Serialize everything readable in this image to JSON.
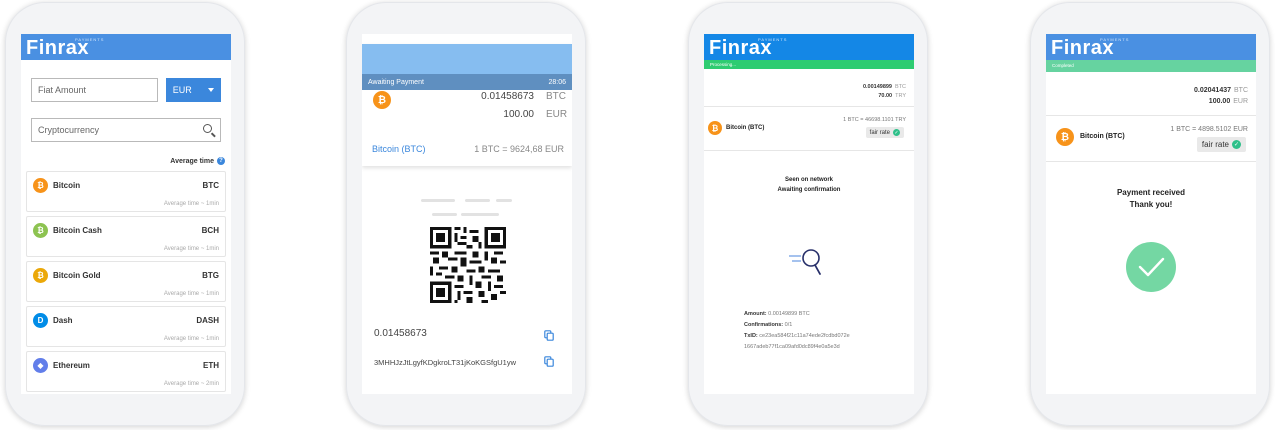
{
  "brand": {
    "name": "Finrax",
    "tag": "PAYMENTS"
  },
  "screen1": {
    "fiat_placeholder": "Fiat Amount",
    "currency": "EUR",
    "crypto_placeholder": "Cryptocurrency",
    "avg_time_header": "Average time",
    "coins": [
      {
        "name": "Bitcoin",
        "symbol": "BTC",
        "time": "Average time ~ 1min",
        "icon": "bitcoin-icon",
        "glyph": "₿",
        "color": "#f7931a"
      },
      {
        "name": "Bitcoin Cash",
        "symbol": "BCH",
        "time": "Average time ~ 1min",
        "icon": "bitcoin-cash-icon",
        "glyph": "₿",
        "color": "#8dc351"
      },
      {
        "name": "Bitcoin Gold",
        "symbol": "BTG",
        "time": "Average time ~ 1min",
        "icon": "bitcoin-gold-icon",
        "glyph": "₿",
        "color": "#eba809"
      },
      {
        "name": "Dash",
        "symbol": "DASH",
        "time": "Average time ~ 1min",
        "icon": "dash-icon",
        "glyph": "D",
        "color": "#008ce7"
      },
      {
        "name": "Ethereum",
        "symbol": "ETH",
        "time": "Average time ~ 2min",
        "icon": "ethereum-icon",
        "glyph": "◆",
        "color": "#627eea"
      }
    ]
  },
  "screen2": {
    "status": "Awaiting Payment",
    "timer": "28:06",
    "crypto_amount": "0.01458673",
    "crypto_unit": "BTC",
    "fiat_amount": "100.00",
    "fiat_unit": "EUR",
    "coin_label": "Bitcoin (BTC)",
    "rate": "1 BTC = 9624,68 EUR",
    "copy_amount": "0.01458673",
    "address": "3MHHJzJtLgyfKDgkroLT31jKoKGSfgU1yw"
  },
  "screen3": {
    "progress": "Processing...",
    "crypto_amount": "0.00149899",
    "crypto_unit": "BTC",
    "fiat_amount": "70.00",
    "fiat_unit": "TRY",
    "coin_label": "Bitcoin (BTC)",
    "rate": "1 BTC = 46698.1101 TRY",
    "fair_rate": "fair rate",
    "status_line1": "Seen on network",
    "status_line2": "Awaiting confirmation",
    "amount_label": "Amount:",
    "amount_value": "0.00149899 BTC",
    "confirm_label": "Confirmations:",
    "confirm_value": "0/1",
    "txid_label": "TxID:",
    "txid_value1": "ce23ea584f21c11a74ede2fcdbd072e",
    "txid_value2": "1667adeb77f1ca09afd0dc89f4e0a5e3d"
  },
  "screen4": {
    "progress": "Completed",
    "crypto_amount": "0.02041437",
    "crypto_unit": "BTC",
    "fiat_amount": "100.00",
    "fiat_unit": "EUR",
    "coin_label": "Bitcoin (BTC)",
    "rate": "1 BTC = 4898.5102 EUR",
    "fair_rate": "fair rate",
    "message_line1": "Payment received",
    "message_line2": "Thank you!"
  }
}
